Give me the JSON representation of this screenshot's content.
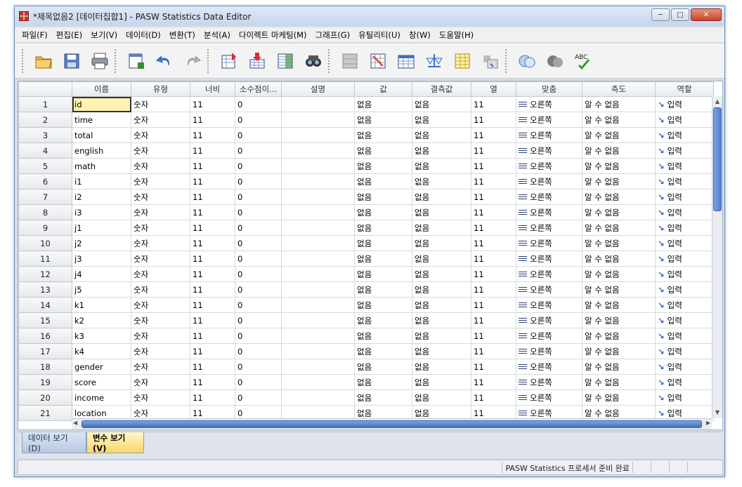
{
  "window": {
    "title": "*제목없음2 [데이터집합1] - PASW Statistics Data Editor"
  },
  "menu": [
    "파일(F)",
    "편집(E)",
    "보기(V)",
    "데이터(D)",
    "변환(T)",
    "분석(A)",
    "다이렉트 마케팅(M)",
    "그래프(G)",
    "유틸리티(U)",
    "창(W)",
    "도움말(H)"
  ],
  "toolbar": {
    "buttons": [
      "open-folder-icon",
      "save-icon",
      "print-icon",
      "dialog-recall-icon",
      "undo-icon",
      "redo-icon",
      "goto-case-icon",
      "goto-variable-icon",
      "variables-icon",
      "find-icon",
      "insert-cases-icon",
      "insert-variable-icon",
      "split-file-icon",
      "weight-cases-icon",
      "select-cases-icon",
      "value-labels-icon",
      "use-sets-icon",
      "show-all-icon",
      "spell-check-icon"
    ],
    "spell_label": "ABC"
  },
  "columns": [
    "",
    "이름",
    "유형",
    "너비",
    "소수점이...",
    "설명",
    "값",
    "결측값",
    "열",
    "맞춤",
    "측도",
    "역할"
  ],
  "rows": [
    {
      "n": "1",
      "name": "id"
    },
    {
      "n": "2",
      "name": "time"
    },
    {
      "n": "3",
      "name": "total"
    },
    {
      "n": "4",
      "name": "english"
    },
    {
      "n": "5",
      "name": "math"
    },
    {
      "n": "6",
      "name": "i1"
    },
    {
      "n": "7",
      "name": "i2"
    },
    {
      "n": "8",
      "name": "i3"
    },
    {
      "n": "9",
      "name": "j1"
    },
    {
      "n": "10",
      "name": "j2"
    },
    {
      "n": "11",
      "name": "j3"
    },
    {
      "n": "12",
      "name": "j4"
    },
    {
      "n": "13",
      "name": "j5"
    },
    {
      "n": "14",
      "name": "k1"
    },
    {
      "n": "15",
      "name": "k2"
    },
    {
      "n": "16",
      "name": "k3"
    },
    {
      "n": "17",
      "name": "k4"
    },
    {
      "n": "18",
      "name": "gender"
    },
    {
      "n": "19",
      "name": "score"
    },
    {
      "n": "20",
      "name": "income"
    },
    {
      "n": "21",
      "name": "location"
    }
  ],
  "defaults": {
    "type": "숫자",
    "width": "11",
    "decimals": "0",
    "label": "",
    "values": "없음",
    "missing": "없음",
    "columns": "11",
    "align": "오른쪽",
    "measure": "알 수 없음",
    "role": "입력"
  },
  "tabs": {
    "data_view": "데이터 보기(D)",
    "variable_view": "변수 보기(V)"
  },
  "status": {
    "text": "PASW Statistics 프로세서 준비 완료"
  }
}
